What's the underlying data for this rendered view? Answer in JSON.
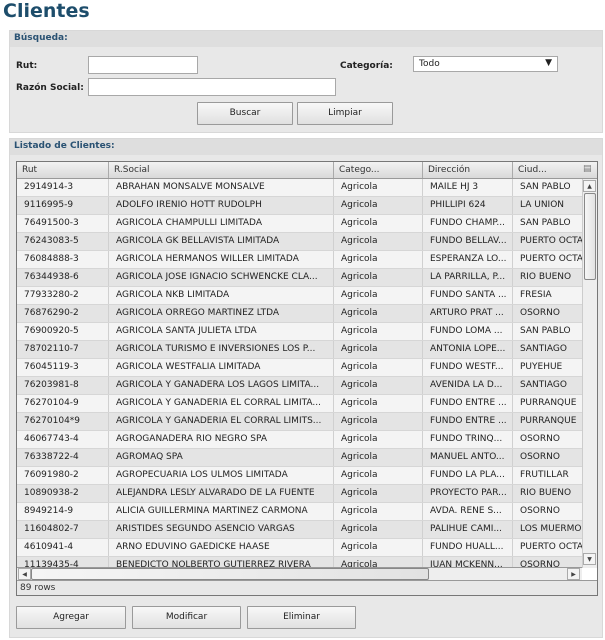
{
  "title": "Clientes",
  "search": {
    "header": "Búsqueda:",
    "rut_label": "Rut:",
    "rut_value": "",
    "razon_label": "Razón Social:",
    "razon_value": "",
    "categoria_label": "Categoría:",
    "categoria_value": "Todo",
    "buscar": "Buscar",
    "limpiar": "Limpiar"
  },
  "list": {
    "header": "Listado de Clientes:",
    "columns": [
      "Rut",
      "R.Social",
      "Catego...",
      "Dirección",
      "Ciud..."
    ],
    "rows": [
      [
        "2914914-3",
        "ABRAHAN MONSALVE MONSALVE",
        "Agricola",
        "MAILE HJ 3",
        "SAN PABLO"
      ],
      [
        "9116995-9",
        "ADOLFO IRENIO HOTT RUDOLPH",
        "Agricola",
        "PHILLIPI 624",
        "LA UNION"
      ],
      [
        "76491500-3",
        "AGRICOLA CHAMPULLI LIMITADA",
        "Agricola",
        "FUNDO CHAMP...",
        "SAN PABLO"
      ],
      [
        "76243083-5",
        "AGRICOLA GK BELLAVISTA LIMITADA",
        "Agricola",
        "FUNDO BELLAV...",
        "PUERTO OCTA"
      ],
      [
        "76084888-3",
        "AGRICOLA HERMANOS WILLER LIMITADA",
        "Agricola",
        "ESPERANZA LO...",
        "PUERTO OCTA"
      ],
      [
        "76344938-6",
        "AGRICOLA JOSE IGNACIO SCHWENCKE CLA...",
        "Agricola",
        "LA PARRILLA, P...",
        "RIO BUENO"
      ],
      [
        "77933280-2",
        "AGRICOLA NKB LIMITADA",
        "Agricola",
        "FUNDO SANTA ...",
        "FRESIA"
      ],
      [
        "76876290-2",
        "AGRICOLA ORREGO MARTINEZ LTDA",
        "Agricola",
        "ARTURO PRAT ...",
        "OSORNO"
      ],
      [
        "76900920-5",
        "AGRICOLA SANTA JULIETA LTDA",
        "Agricola",
        "FUNDO LOMA ...",
        "SAN PABLO"
      ],
      [
        "78702110-7",
        "AGRICOLA TURISMO E INVERSIONES LOS P...",
        "Agricola",
        "ANTONIA LOPE...",
        "SANTIAGO"
      ],
      [
        "76045119-3",
        "AGRICOLA WESTFALIA LIMITADA",
        "Agricola",
        "FUNDO WESTF...",
        "PUYEHUE"
      ],
      [
        "76203981-8",
        "AGRICOLA Y GANADERA LOS LAGOS LIMITA...",
        "Agricola",
        "AVENIDA LA D...",
        "SANTIAGO"
      ],
      [
        "76270104-9",
        "AGRICOLA Y GANADERIA EL CORRAL LIMITA...",
        "Agricola",
        "FUNDO ENTRE ...",
        "PURRANQUE"
      ],
      [
        "76270104*9",
        "AGRICOLA Y GANADERIA EL CORRAL LIMITS...",
        "Agricola",
        "FUNDO ENTRE ...",
        "PURRANQUE"
      ],
      [
        "46067743-4",
        "AGROGANADERA RIO NEGRO SPA",
        "Agricola",
        "FUNDO TRINQ...",
        "OSORNO"
      ],
      [
        "76338722-4",
        "AGROMAQ SPA",
        "Agricola",
        "MANUEL ANTO...",
        "OSORNO"
      ],
      [
        "76091980-2",
        "AGROPECUARIA LOS ULMOS LIMITADA",
        "Agricola",
        "FUNDO LA PLA...",
        "FRUTILLAR"
      ],
      [
        "10890938-2",
        "ALEJANDRA LESLY ALVARADO DE LA FUENTE",
        "Agricola",
        "PROYECTO PAR...",
        "RIO BUENO"
      ],
      [
        "8949214-9",
        "ALICIA GUILLERMINA MARTINEZ CARMONA",
        "Agricola",
        "AVDA. RENE S...",
        "OSORNO"
      ],
      [
        "11604802-7",
        "ARISTIDES SEGUNDO ASENCIO VARGAS",
        "Agricola",
        "PALIHUE CAMI...",
        "LOS MUERMOS"
      ],
      [
        "4610941-4",
        "ARNO EDUVINO GAEDICKE HAASE",
        "Agricola",
        "FUNDO HUALL...",
        "PUERTO OCTA"
      ],
      [
        "11139435-4",
        "BENEDICTO NOLBERTO GUTIERREZ RIVERA",
        "Agricola",
        "JUAN MCKENN...",
        "OSORNO"
      ]
    ],
    "row_count": "89 rows"
  },
  "actions": {
    "agregar": "Agregar",
    "modificar": "Modificar",
    "eliminar": "Eliminar"
  }
}
